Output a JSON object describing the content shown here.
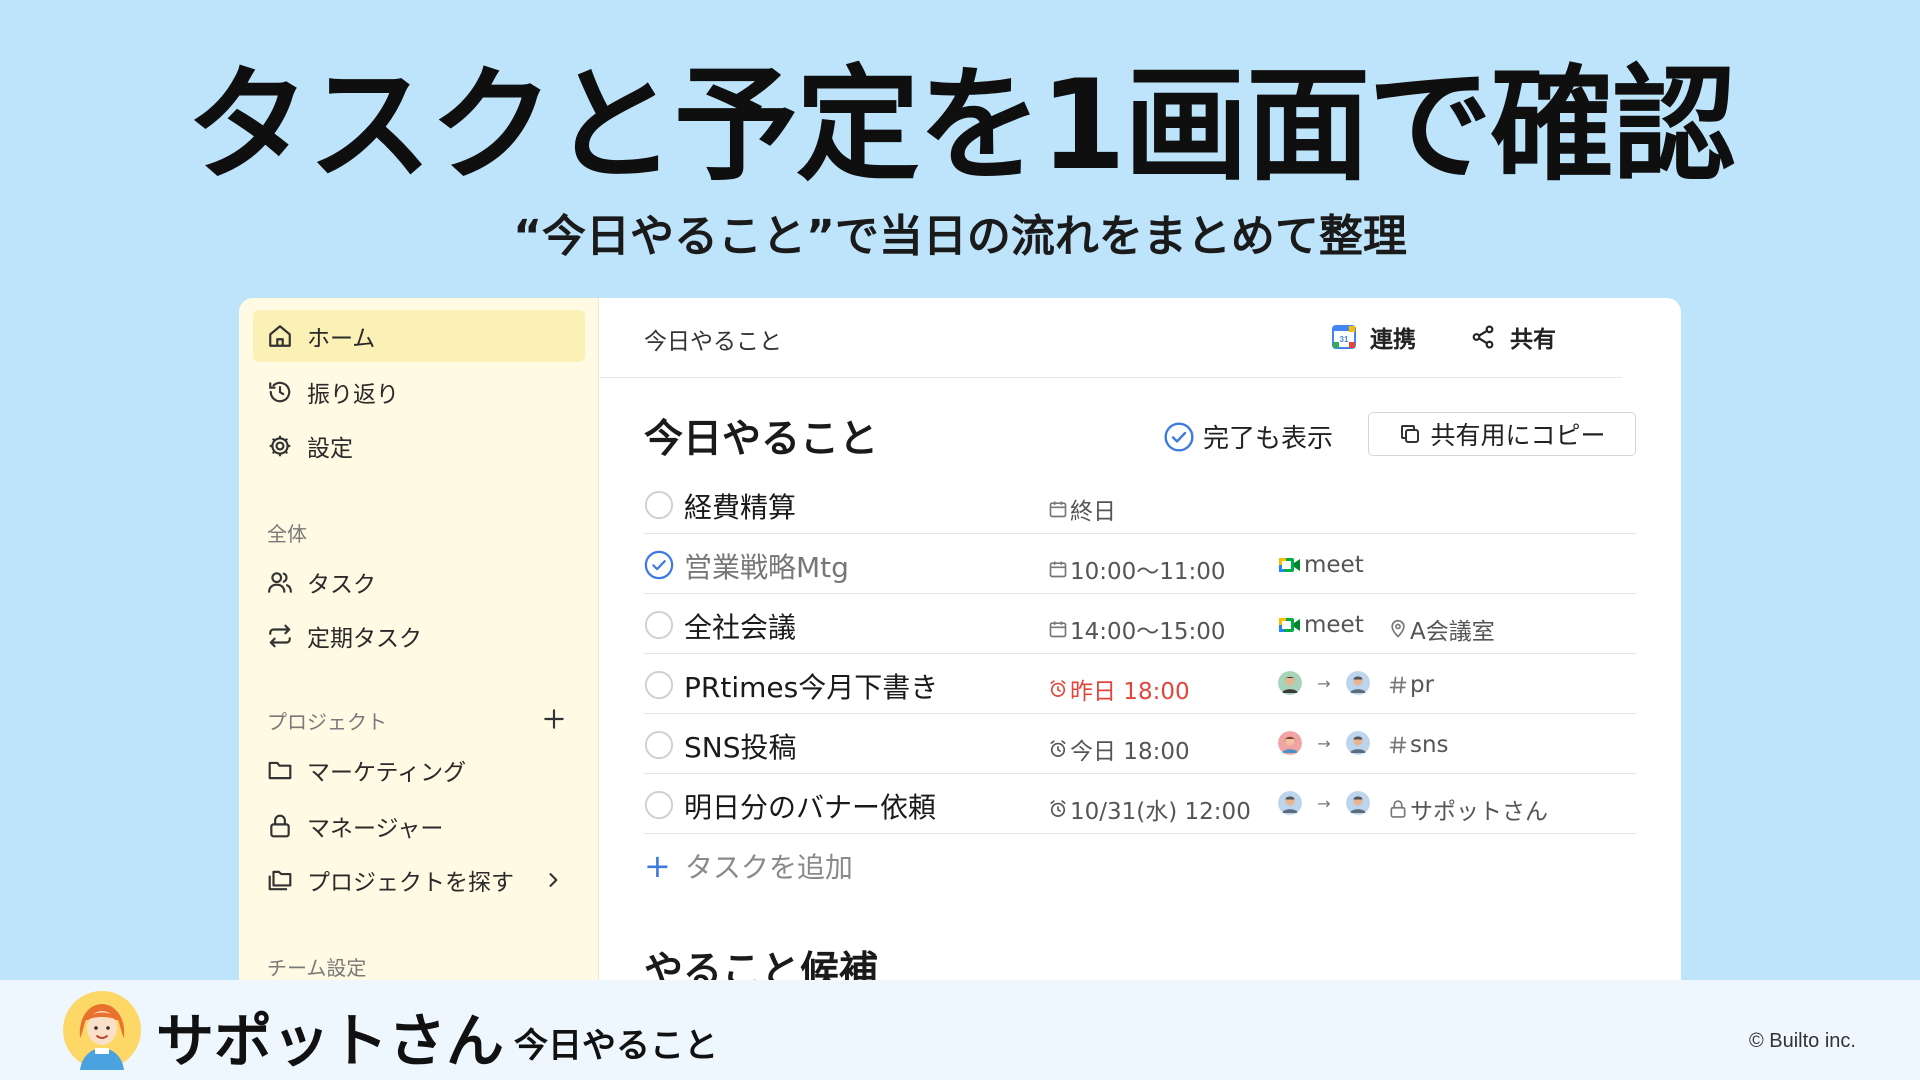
{
  "hero": {
    "title": "タスクと予定を1画面で確認",
    "subtitle": "“今日やること”で当日の流れをまとめて整理"
  },
  "sidebar": {
    "nav": [
      {
        "label": "ホーム",
        "icon": "home-icon",
        "active": true
      },
      {
        "label": "振り返り",
        "icon": "history-icon"
      },
      {
        "label": "設定",
        "icon": "gear-icon"
      }
    ],
    "section_all": "全体",
    "all_items": [
      {
        "label": "タスク",
        "icon": "users-icon"
      },
      {
        "label": "定期タスク",
        "icon": "repeat-icon"
      }
    ],
    "section_projects": "プロジェクト",
    "projects": [
      {
        "label": "マーケティング",
        "icon": "folder-icon"
      },
      {
        "label": "マネージャー",
        "icon": "lock-icon"
      },
      {
        "label": "プロジェクトを探す",
        "icon": "folders-icon"
      }
    ],
    "section_team": "チーム設定"
  },
  "topbar": {
    "title": "今日やること",
    "integrate_label": "連携",
    "share_label": "共有"
  },
  "today": {
    "heading": "今日やること",
    "show_done_label": "完了も表示",
    "copy_label": "共有用にコピー",
    "tasks": [
      {
        "title": "経費精算",
        "done": false,
        "time": "終日",
        "time_icon": "calendar-icon"
      },
      {
        "title": "営業戦略Mtg",
        "done": true,
        "time": "10:00～11:00",
        "time_icon": "calendar-icon",
        "meet": "meet"
      },
      {
        "title": "全社会議",
        "done": false,
        "time": "14:00～15:00",
        "time_icon": "calendar-icon",
        "meet": "meet",
        "location": "A会議室"
      },
      {
        "title": "PRtimes今月下書き",
        "done": false,
        "time": "昨日 18:00",
        "time_icon": "alarm-icon",
        "overdue": true,
        "tag": "pr"
      },
      {
        "title": "SNS投稿",
        "done": false,
        "time": "今日 18:00",
        "time_icon": "alarm-icon",
        "tag": "sns"
      },
      {
        "title": "明日分のバナー依頼",
        "done": false,
        "time": "10/31(水) 12:00",
        "time_icon": "alarm-icon",
        "private": "サポットさん"
      }
    ],
    "add_task_label": "タスクを追加"
  },
  "candidates": {
    "heading": "やること候補"
  },
  "footer": {
    "brand": "サポットさん",
    "brand_sub": "今日やること",
    "copyright": "© Builto inc."
  },
  "colors": {
    "background": "#bde4fb",
    "sidebar": "#fefae3",
    "sidebar_active": "#fbf1b7",
    "accent_blue": "#3d7be0",
    "overdue_red": "#e0463b",
    "footer": "#eef6fe"
  }
}
